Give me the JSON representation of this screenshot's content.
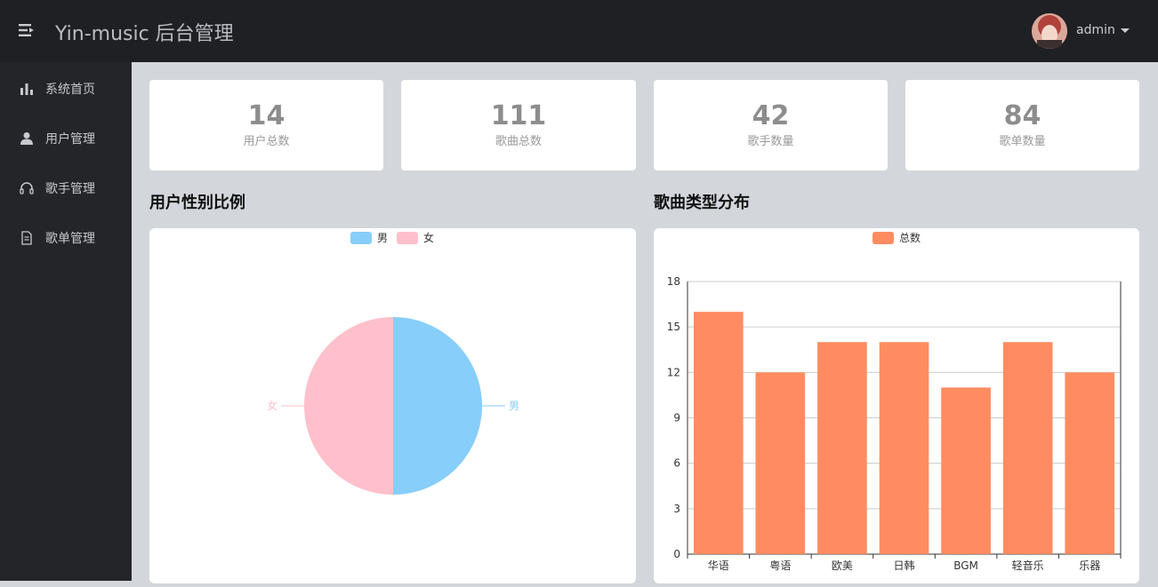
{
  "header": {
    "title": "Yin-music 后台管理",
    "user": "admin",
    "icons": {
      "menu": "menu-fold-icon",
      "caret": "caret-down-icon"
    }
  },
  "sidebar": {
    "items": [
      {
        "label": "系统首页",
        "icon": "bar-chart-icon"
      },
      {
        "label": "用户管理",
        "icon": "user-icon"
      },
      {
        "label": "歌手管理",
        "icon": "headphones-icon"
      },
      {
        "label": "歌单管理",
        "icon": "document-icon"
      }
    ]
  },
  "stats": [
    {
      "value": "14",
      "label": "用户总数"
    },
    {
      "value": "111",
      "label": "歌曲总数"
    },
    {
      "value": "42",
      "label": "歌手数量"
    },
    {
      "value": "84",
      "label": "歌单数量"
    }
  ],
  "sections": {
    "gender_title": "用户性别比例",
    "type_title": "歌曲类型分布"
  },
  "colors": {
    "male": "#87cefa",
    "female": "#ffc0cb",
    "bar": "#ff8c61"
  },
  "chart_data": [
    {
      "type": "pie",
      "legend": [
        "男",
        "女"
      ],
      "categories": [
        "男",
        "女"
      ],
      "values": [
        1,
        1
      ],
      "legend_position": "top-center"
    },
    {
      "type": "bar",
      "legend": [
        "总数"
      ],
      "categories": [
        "华语",
        "粤语",
        "欧美",
        "日韩",
        "BGM",
        "轻音乐",
        "乐器"
      ],
      "series": [
        {
          "name": "总数",
          "values": [
            16,
            12,
            14,
            14,
            11,
            14,
            12
          ]
        }
      ],
      "ylim": [
        0,
        18
      ],
      "yticks": [
        "0",
        "3",
        "6",
        "9",
        "12",
        "15",
        "18"
      ],
      "grid": true,
      "legend_position": "top-center"
    }
  ]
}
